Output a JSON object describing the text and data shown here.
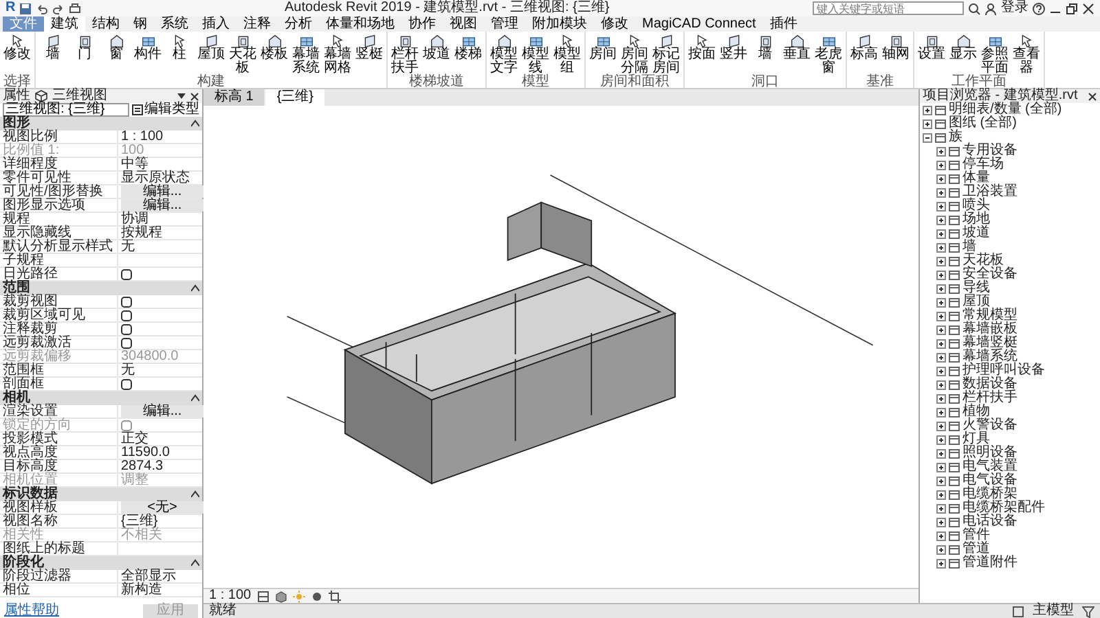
{
  "title_bar": {
    "app_logo": "R",
    "title": "Autodesk Revit 2019 - 建筑模型.rvt - 三维视图: {三维}",
    "search": {
      "placeholder": "键入关键字或短语"
    },
    "sign_in": "登录"
  },
  "ribbon_tabs": [
    {
      "label": "文件",
      "kind": "file",
      "selected": false
    },
    {
      "label": "建筑",
      "kind": "tab",
      "selected": true
    },
    {
      "label": "结构",
      "kind": "tab",
      "selected": false
    },
    {
      "label": "钢",
      "kind": "tab",
      "selected": false
    },
    {
      "label": "系统",
      "kind": "tab",
      "selected": false
    },
    {
      "label": "插入",
      "kind": "tab",
      "selected": false
    },
    {
      "label": "注释",
      "kind": "tab",
      "selected": false
    },
    {
      "label": "分析",
      "kind": "tab",
      "selected": false
    },
    {
      "label": "体量和场地",
      "kind": "tab",
      "selected": false
    },
    {
      "label": "协作",
      "kind": "tab",
      "selected": false
    },
    {
      "label": "视图",
      "kind": "tab",
      "selected": false
    },
    {
      "label": "管理",
      "kind": "tab",
      "selected": false
    },
    {
      "label": "附加模块",
      "kind": "tab",
      "selected": false
    },
    {
      "label": "修改",
      "kind": "tab",
      "selected": false
    },
    {
      "label": "MagiCAD Connect",
      "kind": "tab",
      "selected": false
    },
    {
      "label": "插件",
      "kind": "tab",
      "selected": false
    }
  ],
  "ribbon_panels": [
    {
      "label": "选择",
      "buttons": [
        "修改"
      ]
    },
    {
      "label": "构建",
      "buttons": [
        "墙",
        "门",
        "窗",
        "构件",
        "柱",
        "屋顶",
        "天花板",
        "楼板",
        "幕墙系统",
        "幕墙网格",
        "竖梃"
      ]
    },
    {
      "label": "楼梯坡道",
      "buttons": [
        "栏杆扶手",
        "坡道",
        "楼梯"
      ]
    },
    {
      "label": "模型",
      "buttons": [
        "模型文字",
        "模型线",
        "模型组"
      ]
    },
    {
      "label": "房间和面积",
      "buttons": [
        "房间",
        "房间分隔",
        "标记房间"
      ]
    },
    {
      "label": "洞口",
      "buttons": [
        "按面",
        "竖井",
        "墙",
        "垂直",
        "老虎窗"
      ]
    },
    {
      "label": "基准",
      "buttons": [
        "标高",
        "轴网"
      ]
    },
    {
      "label": "工作平面",
      "buttons": [
        "设置",
        "显示",
        "参照平面",
        "查看器"
      ]
    }
  ],
  "properties": {
    "title": "属性",
    "type_name": "三维视图",
    "view_selector": "三维视图: {三维}",
    "edit_type": "编辑类型",
    "groups": [
      {
        "label": "图形",
        "expanded": true,
        "rows": [
          {
            "label": "视图比例",
            "kind": "text",
            "value": "1 : 100",
            "disabled": false
          },
          {
            "label": "比例值 1:",
            "kind": "text",
            "value": "100",
            "disabled": true
          },
          {
            "label": "详细程度",
            "kind": "text",
            "value": "中等",
            "disabled": false
          },
          {
            "label": "零件可见性",
            "kind": "text",
            "value": "显示原状态",
            "disabled": false
          },
          {
            "label": "可见性/图形替换",
            "kind": "button",
            "value": "编辑...",
            "disabled": false
          },
          {
            "label": "图形显示选项",
            "kind": "button",
            "value": "编辑...",
            "disabled": false
          },
          {
            "label": "规程",
            "kind": "text",
            "value": "协调",
            "disabled": false
          },
          {
            "label": "显示隐藏线",
            "kind": "text",
            "value": "按规程",
            "disabled": false
          },
          {
            "label": "默认分析显示样式",
            "kind": "text",
            "value": "无",
            "disabled": false
          },
          {
            "label": "子规程",
            "kind": "text",
            "disabled": false
          },
          {
            "label": "日光路径",
            "kind": "checkbox",
            "checked": false,
            "disabled": false
          }
        ]
      },
      {
        "label": "范围",
        "expanded": true,
        "rows": [
          {
            "label": "裁剪视图",
            "kind": "checkbox",
            "checked": false,
            "disabled": false
          },
          {
            "label": "裁剪区域可见",
            "kind": "checkbox",
            "checked": false,
            "disabled": false
          },
          {
            "label": "注释裁剪",
            "kind": "checkbox",
            "checked": false,
            "disabled": false
          },
          {
            "label": "远剪裁激活",
            "kind": "checkbox",
            "checked": false,
            "disabled": false
          },
          {
            "label": "远剪裁偏移",
            "kind": "text",
            "value": "304800.0",
            "disabled": true
          },
          {
            "label": "范围框",
            "kind": "text",
            "value": "无",
            "disabled": false
          },
          {
            "label": "剖面框",
            "kind": "checkbox",
            "checked": false,
            "disabled": false
          }
        ]
      },
      {
        "label": "相机",
        "expanded": true,
        "rows": [
          {
            "label": "渲染设置",
            "kind": "button",
            "value": "编辑...",
            "disabled": false
          },
          {
            "label": "锁定的方向",
            "kind": "checkbox",
            "checked": false,
            "disabled": true
          },
          {
            "label": "投影模式",
            "kind": "text",
            "value": "正交",
            "disabled": false
          },
          {
            "label": "视点高度",
            "kind": "text",
            "value": "11590.0",
            "disabled": false
          },
          {
            "label": "目标高度",
            "kind": "text",
            "value": "2874.3",
            "disabled": false
          },
          {
            "label": "相机位置",
            "kind": "text",
            "value": "调整",
            "disabled": true
          }
        ]
      },
      {
        "label": "标识数据",
        "expanded": true,
        "rows": [
          {
            "label": "视图样板",
            "kind": "button",
            "value": "<无>",
            "disabled": false
          },
          {
            "label": "视图名称",
            "kind": "text",
            "value": "{三维}",
            "disabled": false
          },
          {
            "label": "相关性",
            "kind": "text",
            "value": "不相关",
            "disabled": true
          },
          {
            "label": "图纸上的标题",
            "kind": "text",
            "disabled": false
          }
        ]
      },
      {
        "label": "阶段化",
        "expanded": true,
        "rows": [
          {
            "label": "阶段过滤器",
            "kind": "text",
            "value": "全部显示",
            "disabled": false
          },
          {
            "label": "相位",
            "kind": "text",
            "value": "新构造",
            "disabled": false
          }
        ]
      }
    ],
    "help_link": "属性帮助",
    "apply": "应用"
  },
  "view_tabs": [
    {
      "label": "标高 1",
      "selected": false
    },
    {
      "label": "{三维}",
      "selected": true
    }
  ],
  "view_control_bar": {
    "scale": "1 : 100"
  },
  "project_browser": {
    "title": "项目浏览器 - 建筑模型.rvt",
    "items": [
      {
        "label": "明细表/数量 (全部)",
        "expanded": false
      },
      {
        "label": "图纸 (全部)",
        "expanded": false
      },
      {
        "label": "族",
        "expanded": true,
        "children": [
          {
            "label": "专用设备",
            "expanded": false
          },
          {
            "label": "停车场",
            "expanded": false
          },
          {
            "label": "体量",
            "expanded": false
          },
          {
            "label": "卫浴装置",
            "expanded": false
          },
          {
            "label": "喷头",
            "expanded": false
          },
          {
            "label": "场地",
            "expanded": false
          },
          {
            "label": "坡道",
            "expanded": false
          },
          {
            "label": "墙",
            "expanded": false
          },
          {
            "label": "天花板",
            "expanded": false
          },
          {
            "label": "安全设备",
            "expanded": false
          },
          {
            "label": "导线",
            "expanded": false
          },
          {
            "label": "屋顶",
            "expanded": false
          },
          {
            "label": "常规模型",
            "expanded": false
          },
          {
            "label": "幕墙嵌板",
            "expanded": false
          },
          {
            "label": "幕墙竖梃",
            "expanded": false
          },
          {
            "label": "幕墙系统",
            "expanded": false
          },
          {
            "label": "护理呼叫设备",
            "expanded": false
          },
          {
            "label": "数据设备",
            "expanded": false
          },
          {
            "label": "栏杆扶手",
            "expanded": false
          },
          {
            "label": "植物",
            "expanded": false
          },
          {
            "label": "火警设备",
            "expanded": false
          },
          {
            "label": "灯具",
            "expanded": false
          },
          {
            "label": "照明设备",
            "expanded": false
          },
          {
            "label": "电气装置",
            "expanded": false
          },
          {
            "label": "电气设备",
            "expanded": false
          },
          {
            "label": "电缆桥架",
            "expanded": false
          },
          {
            "label": "电缆桥架配件",
            "expanded": false
          },
          {
            "label": "电话设备",
            "expanded": false
          },
          {
            "label": "管件",
            "expanded": false
          },
          {
            "label": "管道",
            "expanded": false
          },
          {
            "label": "管道附件",
            "expanded": false
          }
        ]
      }
    ]
  },
  "status_bar": {
    "text": "就绪",
    "model": "主模型"
  }
}
